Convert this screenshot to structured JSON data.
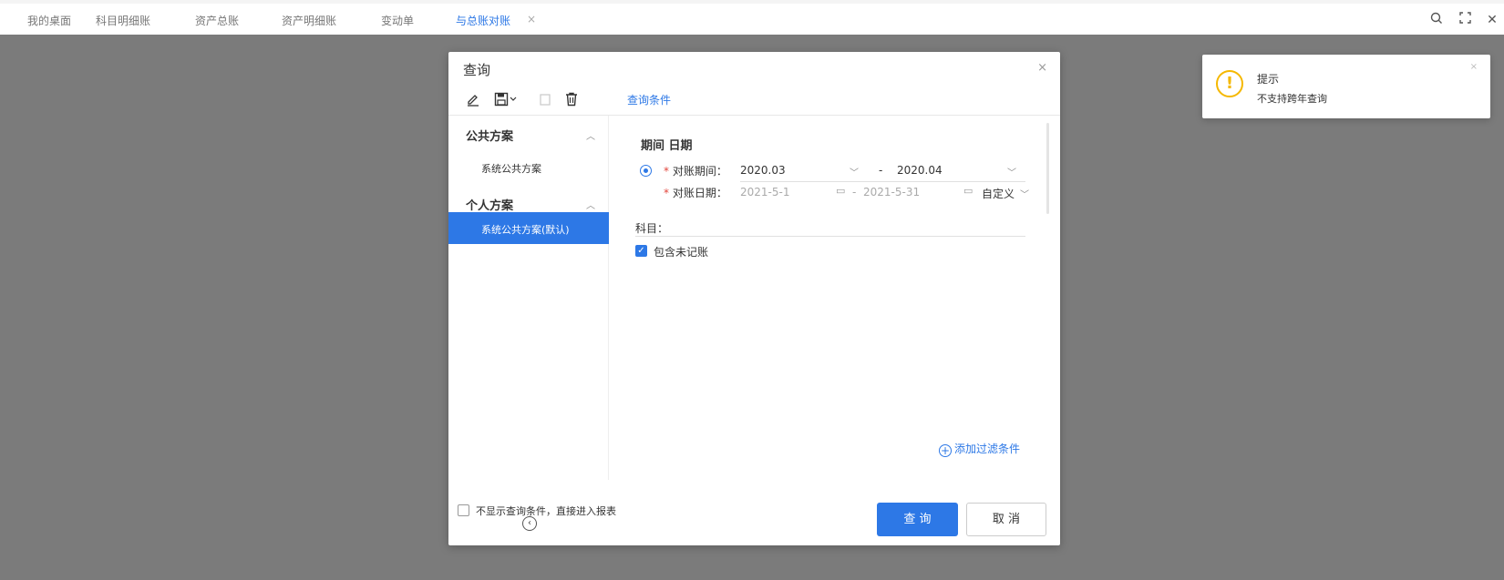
{
  "tabs": [
    {
      "label": "我的桌面"
    },
    {
      "label": "科目明细账"
    },
    {
      "label": "资产总账"
    },
    {
      "label": "资产明细账"
    },
    {
      "label": "变动单"
    },
    {
      "label": "与总账对账",
      "active": true
    }
  ],
  "tab_close": "×",
  "top_icons": {
    "search": "○",
    "fullscreen": "⛶",
    "close": "✕"
  },
  "dialog": {
    "title": "查询",
    "close": "×",
    "condition_tab": "查询条件",
    "left": {
      "public_group": "公共方案",
      "public_items": [
        "系统公共方案"
      ],
      "personal_group": "个人方案",
      "personal_items": [
        "系统公共方案(默认)"
      ]
    },
    "section_title": "期间 日期",
    "period_label": "对账期间：",
    "period_from": "2020.03",
    "period_to": "2020.04",
    "date_label": "对账日期：",
    "date_from": "2021-5-1",
    "date_to": "2021-5-31",
    "date_mode": "自定义",
    "dash": "-",
    "subject_label": "科目：",
    "include_unposted": "包含未记账",
    "add_filter": "添加过滤条件",
    "skip_label": "不显示查询条件，直接进入报表",
    "query_button": "查 询",
    "cancel_button": "取 消"
  },
  "toast": {
    "title": "提示",
    "message": "不支持跨年查询",
    "close": "×"
  },
  "colors": {
    "accent": "#2d78e6",
    "warning": "#f5b800",
    "overlay": "#7b7b7b"
  }
}
